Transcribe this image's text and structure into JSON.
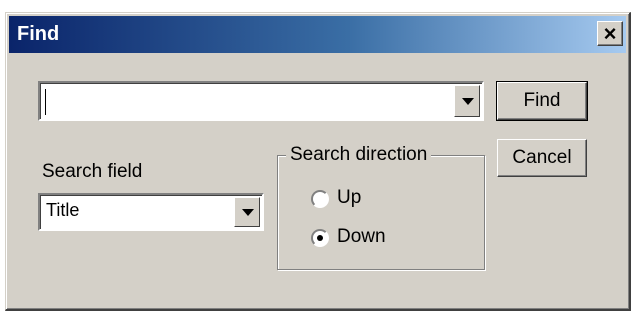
{
  "window": {
    "title": "Find",
    "close_glyph": "×"
  },
  "search": {
    "value": "",
    "placeholder": ""
  },
  "buttons": {
    "find": "Find",
    "cancel": "Cancel"
  },
  "search_field": {
    "label": "Search field",
    "selected": "Title"
  },
  "direction": {
    "legend": "Search direction",
    "options": [
      {
        "label": "Up",
        "checked": false
      },
      {
        "label": "Down",
        "checked": true
      }
    ]
  },
  "colors": {
    "title_start": "#0a246a",
    "title_end": "#a6caf0",
    "face": "#d4d0c8"
  }
}
